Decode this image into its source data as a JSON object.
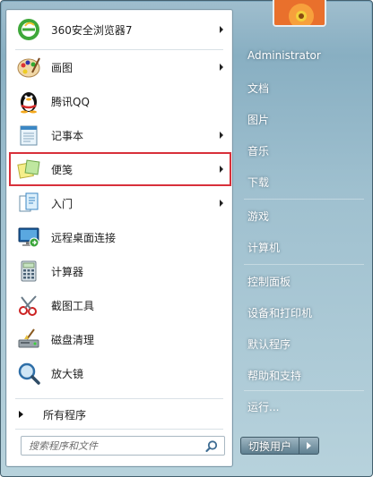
{
  "left_menu": {
    "items": [
      {
        "label": "360安全浏览器7",
        "icon": "browser-360-icon",
        "has_submenu": true
      },
      {
        "label": "画图",
        "icon": "paint-palette-icon",
        "has_submenu": true
      },
      {
        "label": "腾讯QQ",
        "icon": "qq-penguin-icon",
        "has_submenu": false
      },
      {
        "label": "记事本",
        "icon": "notepad-icon",
        "has_submenu": true
      },
      {
        "label": "便笺",
        "icon": "sticky-notes-icon",
        "has_submenu": true,
        "highlighted": true
      },
      {
        "label": "入门",
        "icon": "getting-started-icon",
        "has_submenu": true
      },
      {
        "label": "远程桌面连接",
        "icon": "remote-desktop-icon",
        "has_submenu": false
      },
      {
        "label": "计算器",
        "icon": "calculator-icon",
        "has_submenu": false
      },
      {
        "label": "截图工具",
        "icon": "snipping-tool-icon",
        "has_submenu": false
      },
      {
        "label": "磁盘清理",
        "icon": "disk-cleanup-icon",
        "has_submenu": false
      },
      {
        "label": "放大镜",
        "icon": "magnifier-icon",
        "has_submenu": false
      }
    ],
    "all_programs_label": "所有程序",
    "search_placeholder": "搜索程序和文件"
  },
  "right_menu": {
    "user_name": "Administrator",
    "items": [
      "文档",
      "图片",
      "音乐",
      "下载",
      "游戏",
      "计算机",
      "控制面板",
      "设备和打印机",
      "默认程序",
      "帮助和支持",
      "运行..."
    ],
    "switch_user_label": "切换用户"
  },
  "colors": {
    "highlight_border": "#d8303a",
    "frame": "#9fc0cf"
  }
}
